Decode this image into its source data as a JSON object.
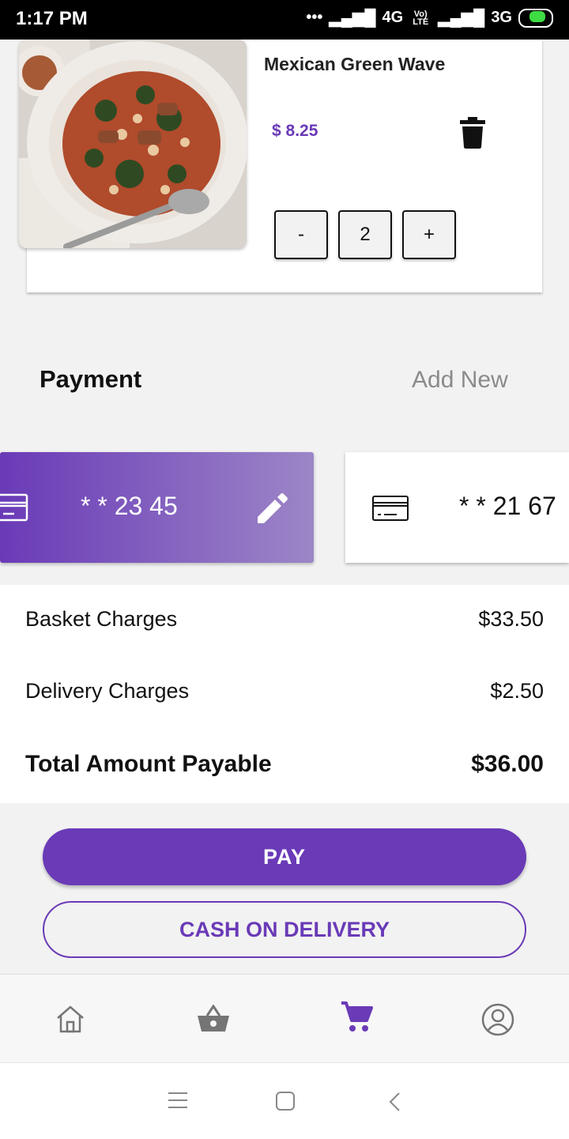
{
  "status": {
    "time": "1:17 PM",
    "network_1": "4G",
    "volte": "Vo) LTE",
    "network_2": "3G"
  },
  "item": {
    "name": "Mexican Green Wave",
    "price": "$ 8.25",
    "quantity": "2",
    "minus_label": "-",
    "plus_label": "+"
  },
  "payment": {
    "title": "Payment",
    "add_new": "Add New",
    "cards": [
      {
        "number": "* * 23 45",
        "selected": true
      },
      {
        "number": "* * 21 67",
        "selected": false
      }
    ]
  },
  "summary": {
    "basket_label": "Basket Charges",
    "basket_value": "$33.50",
    "delivery_label": "Delivery Charges",
    "delivery_value": "$2.50",
    "total_label": "Total Amount Payable",
    "total_value": "$36.00"
  },
  "actions": {
    "pay": "PAY",
    "cod": "CASH ON DELIVERY"
  },
  "bottom_nav": [
    {
      "icon": "home-icon",
      "active": false
    },
    {
      "icon": "basket-icon",
      "active": false
    },
    {
      "icon": "cart-icon",
      "active": true
    },
    {
      "icon": "profile-icon",
      "active": false
    }
  ],
  "system_nav": [
    "menu-icon",
    "home-square-icon",
    "back-icon"
  ],
  "colors": {
    "accent": "#6a3ab7",
    "nav_inactive": "#757575"
  }
}
